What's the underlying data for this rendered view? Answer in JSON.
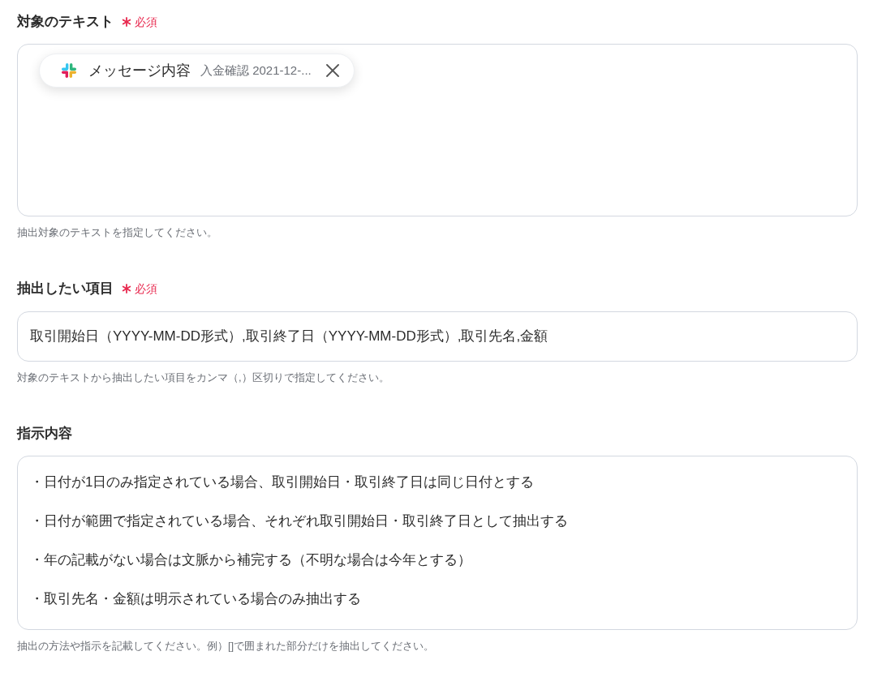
{
  "fields": [
    {
      "kind": "chips",
      "label": "対象のテキスト",
      "required": true,
      "required_text": "必須",
      "chips": [
        {
          "name": "メッセージ内容",
          "value": "入金確認 2021-12-..."
        }
      ],
      "help": "抽出対象のテキストを指定してください。"
    },
    {
      "kind": "input",
      "label": "抽出したい項目",
      "required": true,
      "required_text": "必須",
      "value": "取引開始日（YYYY-MM-DD形式）,取引終了日（YYYY-MM-DD形式）,取引先名,金額",
      "help": "対象のテキストから抽出したい項目をカンマ（,）区切りで指定してください。"
    },
    {
      "kind": "textarea",
      "label": "指示内容",
      "required": false,
      "lines": [
        "・日付が1日のみ指定されている場合、取引開始日・取引終了日は同じ日付とする",
        "・日付が範囲で指定されている場合、それぞれ取引開始日・取引終了日として抽出する",
        "・年の記載がない場合は文脈から補完する（不明な場合は今年とする）",
        "・取引先名・金額は明示されている場合のみ抽出する"
      ],
      "help": "抽出の方法や指示を記載してください。例）[]で囲まれた部分だけを抽出してください。"
    }
  ]
}
